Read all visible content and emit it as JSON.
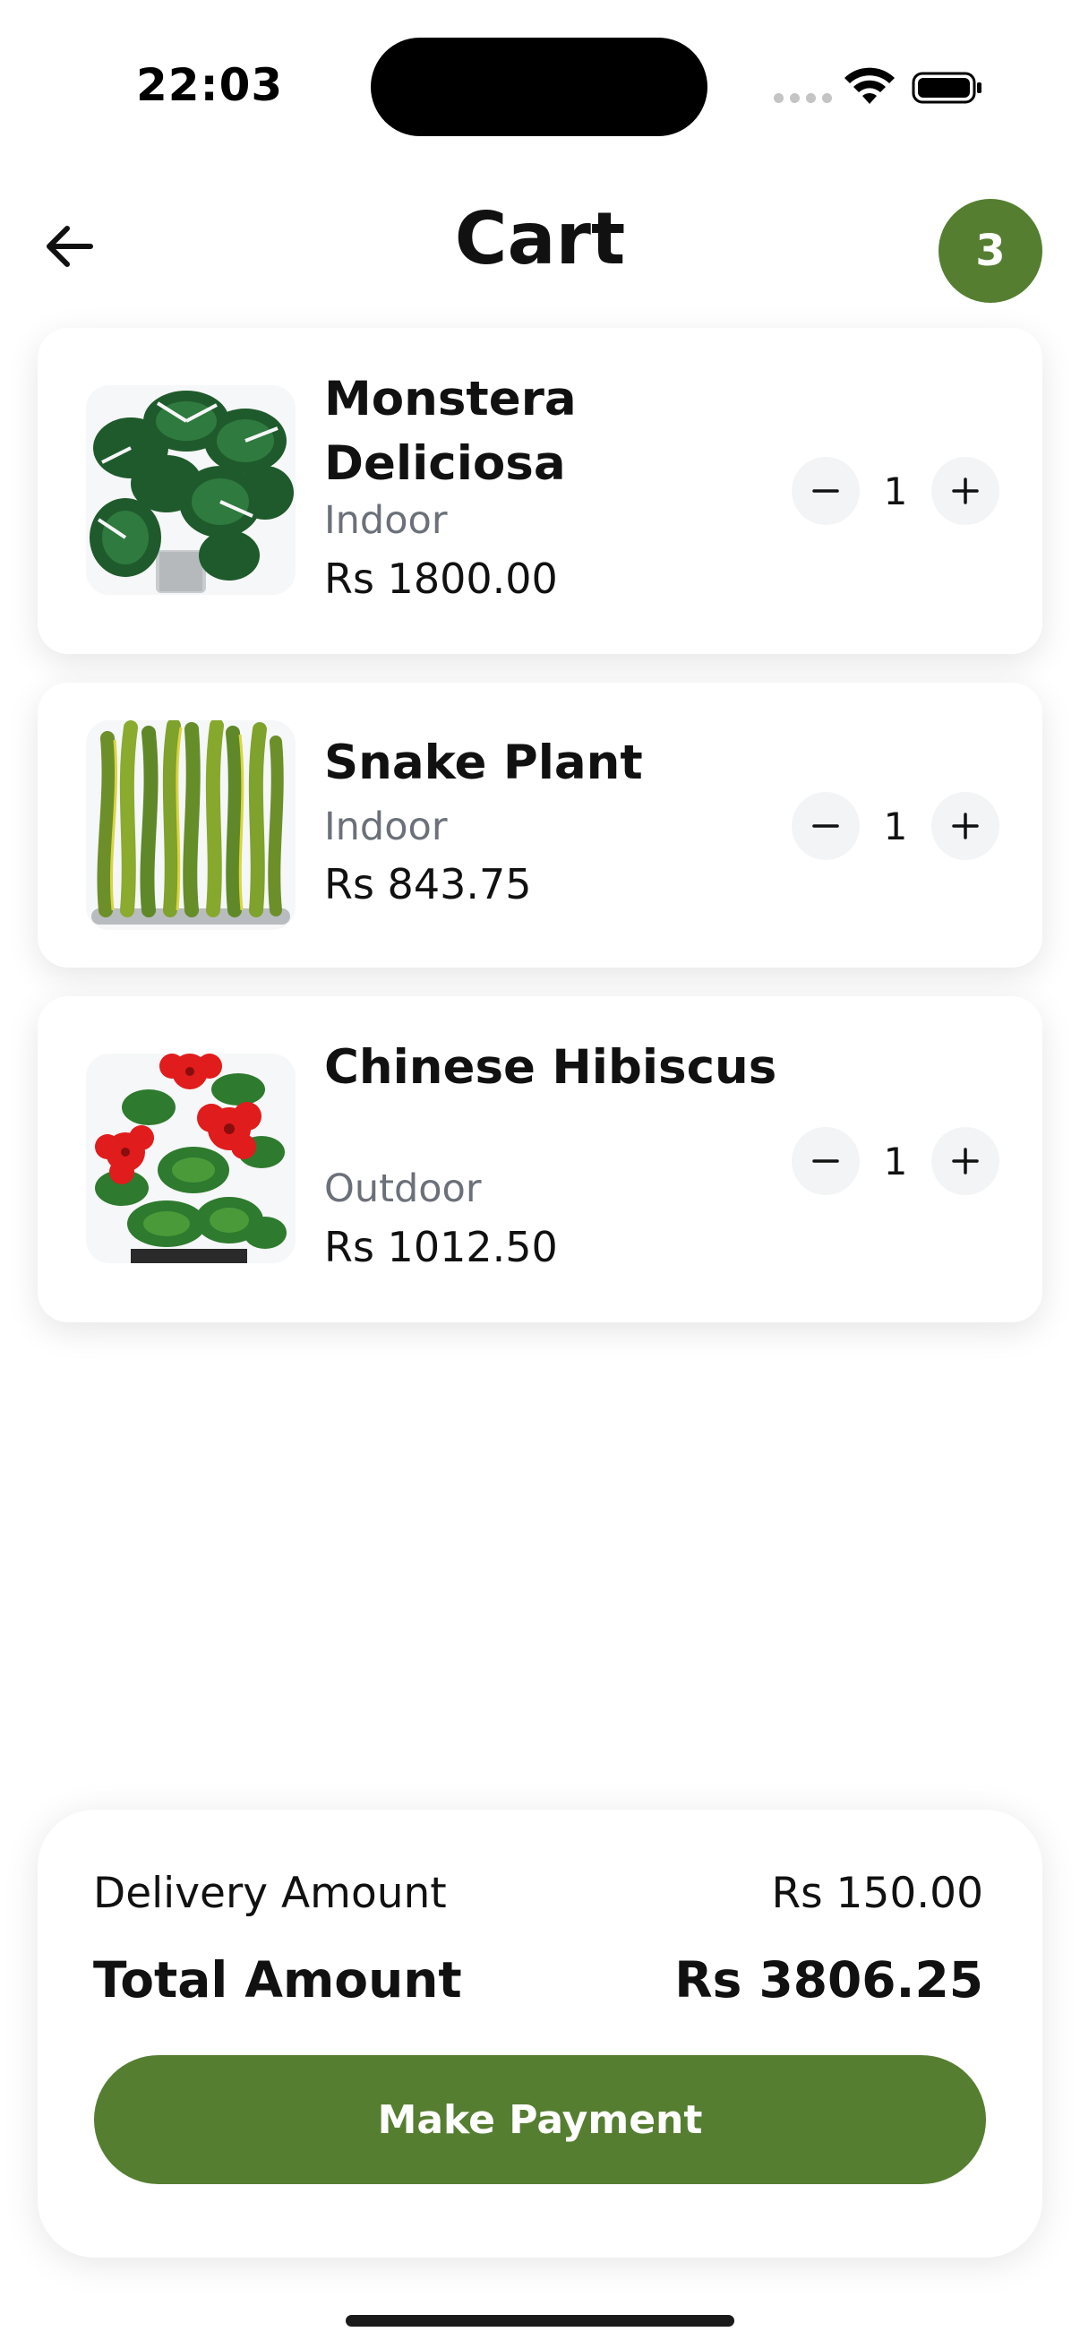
{
  "status_bar": {
    "time": "22:03",
    "icons": [
      "cellular-dots-icon",
      "wifi-icon",
      "battery-icon"
    ]
  },
  "header": {
    "back_icon": "arrow-left-icon",
    "title": "Cart",
    "cart_count": "3"
  },
  "items": [
    {
      "name": "Monstera Deliciosa",
      "category": "Indoor",
      "price": "Rs 1800.00",
      "quantity": "1",
      "image": "monstera-plant-image"
    },
    {
      "name": "Snake Plant",
      "category": "Indoor",
      "price": "Rs 843.75",
      "quantity": "1",
      "image": "snake-plant-image"
    },
    {
      "name": "Chinese Hibiscus",
      "category": "Outdoor",
      "price": "Rs 1012.50",
      "quantity": "1",
      "image": "hibiscus-plant-image"
    }
  ],
  "summary": {
    "delivery_label": "Delivery Amount",
    "delivery_value": "Rs 150.00",
    "total_label": "Total Amount",
    "total_value": "Rs 3806.25",
    "pay_button": "Make Payment"
  },
  "colors": {
    "accent": "#567e31",
    "muted_text": "#6b7079"
  }
}
